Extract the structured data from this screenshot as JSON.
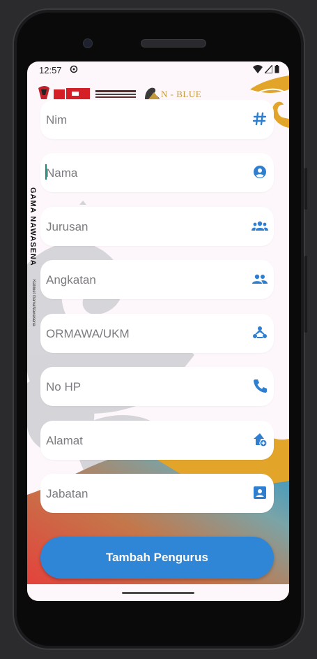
{
  "status_bar": {
    "time": "12:57"
  },
  "branding": {
    "logo_text": "N - BLUE",
    "vertical_title": "GAMA NAWASENA",
    "vertical_caption": "Kabinet GamaNawasena"
  },
  "form": {
    "fields": [
      {
        "label": "Nim",
        "icon": "hash-icon"
      },
      {
        "label": "Nama",
        "icon": "account-circle-icon"
      },
      {
        "label": "Jurusan",
        "icon": "groups-icon"
      },
      {
        "label": "Angkatan",
        "icon": "people-icon"
      },
      {
        "label": "ORMAWA/UKM",
        "icon": "diversity-icon"
      },
      {
        "label": "No HP",
        "icon": "phone-icon"
      },
      {
        "label": "Alamat",
        "icon": "add-home-icon"
      },
      {
        "label": "Jabatan",
        "icon": "contact-card-icon"
      }
    ],
    "submit_label": "Tambah Pengurus"
  },
  "colors": {
    "accent": "#2f86d6",
    "icon": "#2f7fd0",
    "gold": "#e2a52a"
  }
}
